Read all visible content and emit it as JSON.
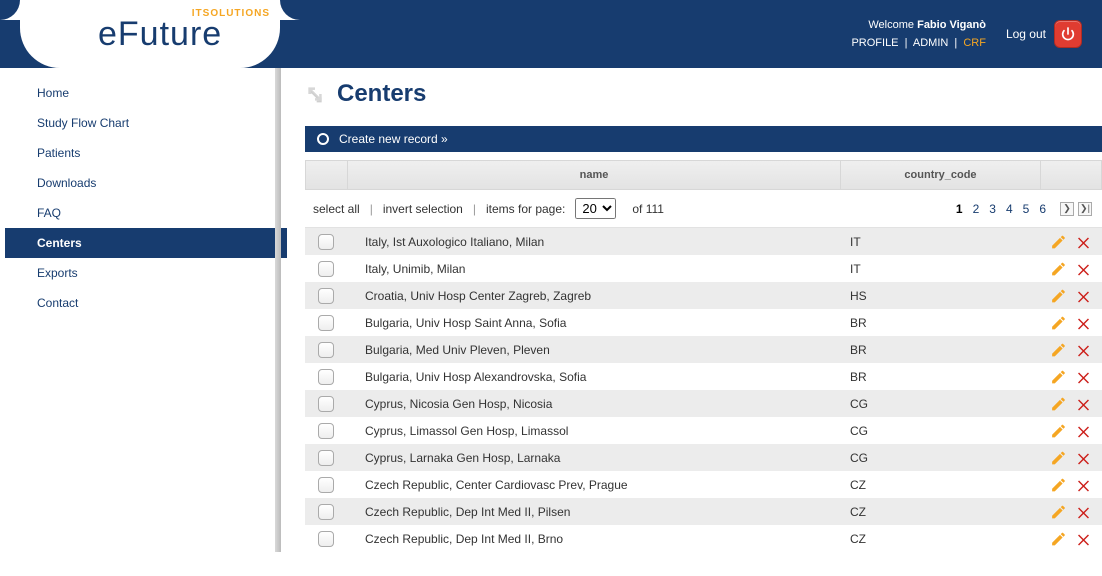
{
  "header": {
    "logo_tag": "ITSOLUTIONS",
    "logo_text": "eFuture",
    "welcome_prefix": "Welcome",
    "user_name": "Fabio Viganò",
    "links": {
      "profile": "PROFILE",
      "admin": "ADMIN",
      "crf": "CRF"
    },
    "logout": "Log out"
  },
  "sidebar": {
    "items": [
      {
        "label": "Home",
        "active": false
      },
      {
        "label": "Study Flow Chart",
        "active": false
      },
      {
        "label": "Patients",
        "active": false
      },
      {
        "label": "Downloads",
        "active": false
      },
      {
        "label": "FAQ",
        "active": false
      },
      {
        "label": "Centers",
        "active": true
      },
      {
        "label": "Exports",
        "active": false
      },
      {
        "label": "Contact",
        "active": false
      }
    ]
  },
  "page": {
    "title": "Centers",
    "create_label": "Create new record »"
  },
  "table": {
    "headers": {
      "name": "name",
      "country_code": "country_code"
    },
    "controls": {
      "select_all": "select all",
      "invert_selection": "invert selection",
      "items_for_page": "items for page:",
      "per_page_value": "20",
      "of_label": "of",
      "total": "111"
    },
    "pager": {
      "pages": [
        "1",
        "2",
        "3",
        "4",
        "5",
        "6"
      ],
      "current": "1"
    },
    "rows": [
      {
        "name": "Italy, Ist Auxologico Italiano, Milan",
        "cc": "IT"
      },
      {
        "name": "Italy, Unimib, Milan",
        "cc": "IT"
      },
      {
        "name": "Croatia, Univ Hosp Center Zagreb, Zagreb",
        "cc": "HS"
      },
      {
        "name": "Bulgaria, Univ Hosp Saint Anna, Sofia",
        "cc": "BR"
      },
      {
        "name": "Bulgaria, Med Univ Pleven, Pleven",
        "cc": "BR"
      },
      {
        "name": "Bulgaria, Univ Hosp Alexandrovska, Sofia",
        "cc": "BR"
      },
      {
        "name": "Cyprus, Nicosia Gen Hosp, Nicosia",
        "cc": "CG"
      },
      {
        "name": "Cyprus, Limassol Gen Hosp, Limassol",
        "cc": "CG"
      },
      {
        "name": "Cyprus, Larnaka Gen Hosp, Larnaka",
        "cc": "CG"
      },
      {
        "name": "Czech Republic, Center Cardiovasc Prev, Prague",
        "cc": "CZ"
      },
      {
        "name": "Czech Republic, Dep Int Med II, Pilsen",
        "cc": "CZ"
      },
      {
        "name": "Czech Republic, Dep Int Med II, Brno",
        "cc": "CZ"
      }
    ]
  }
}
